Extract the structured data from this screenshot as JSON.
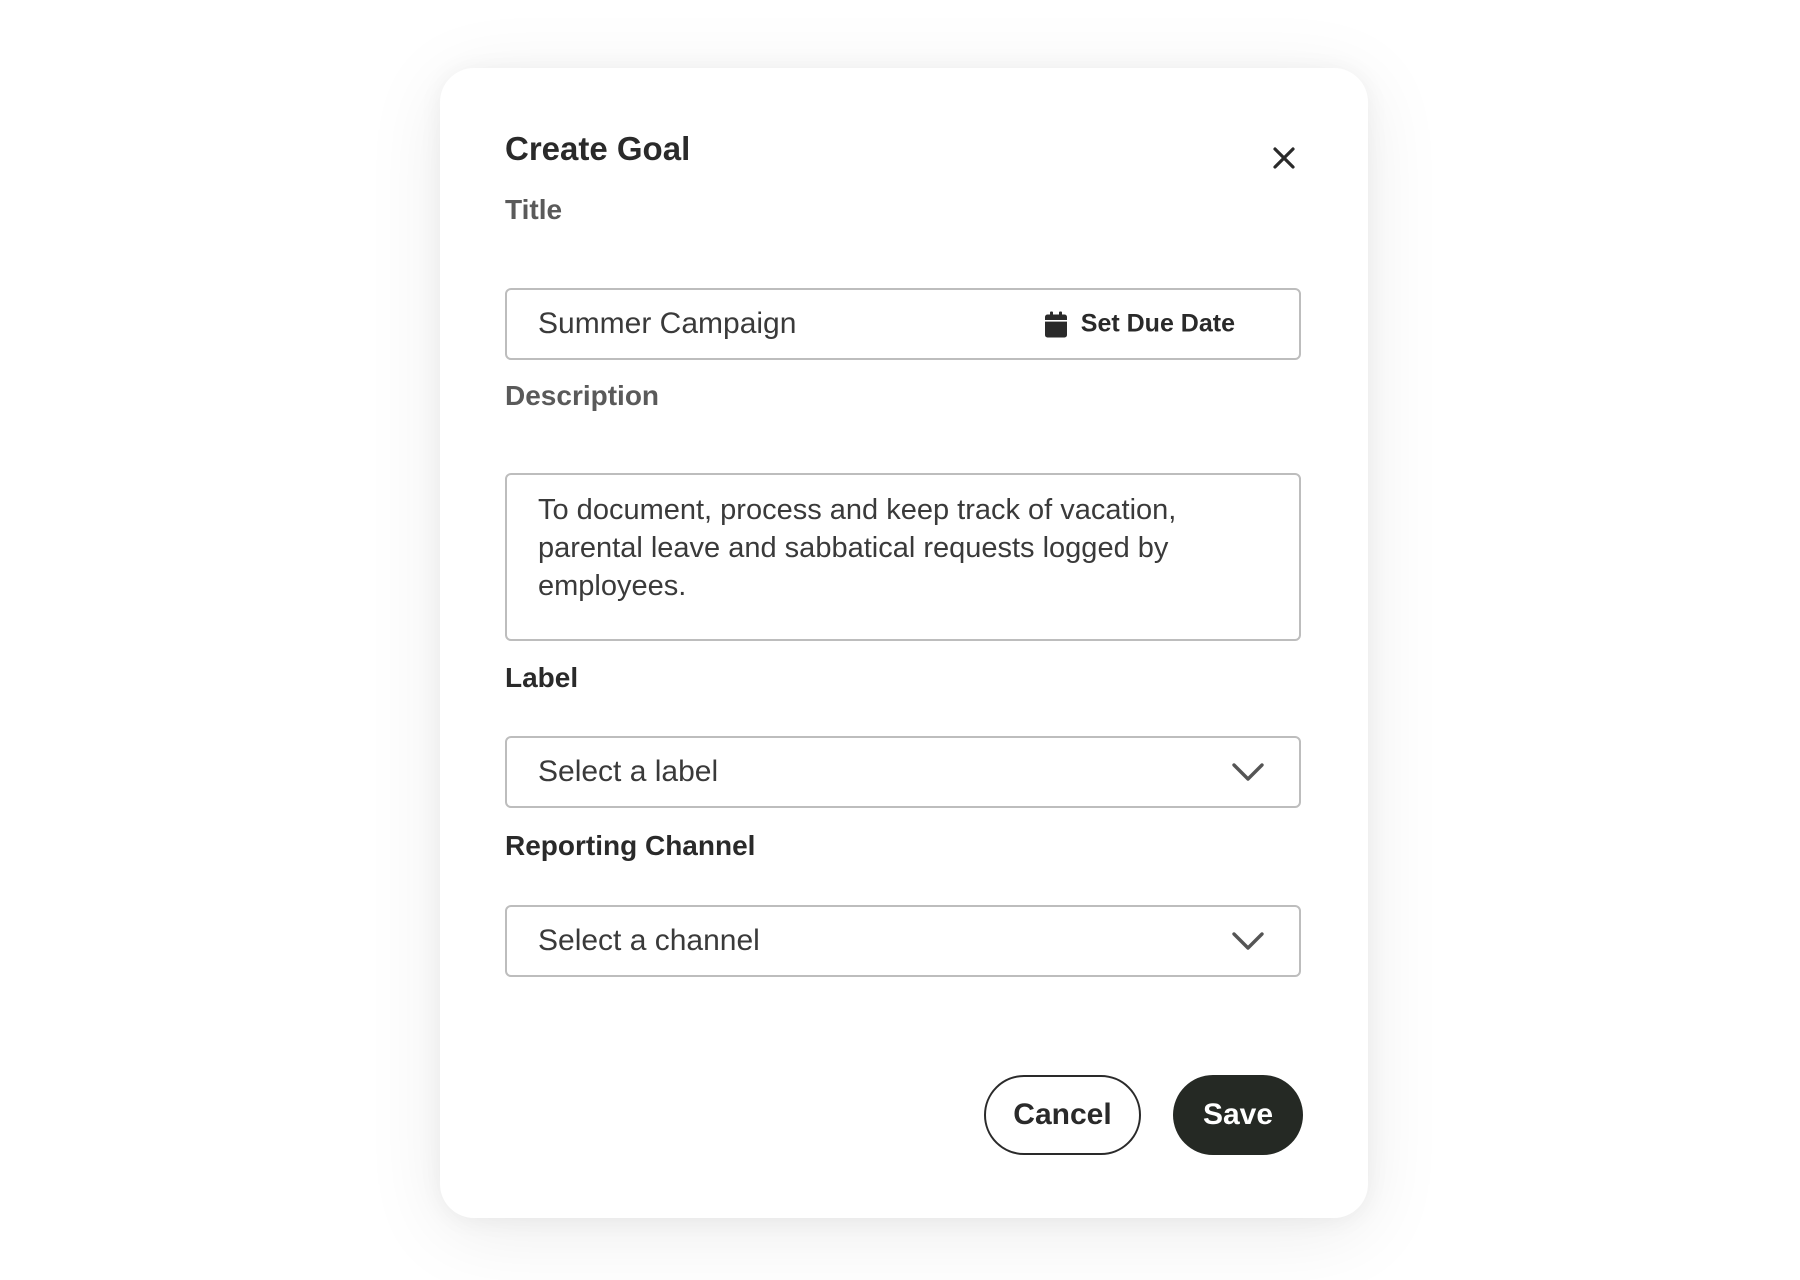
{
  "dialog": {
    "title": "Create Goal",
    "close_icon": "close-icon"
  },
  "fields": {
    "title": {
      "label": "Title",
      "value": "Summer Campaign",
      "due_date_label": "Set Due Date",
      "due_date_icon": "calendar-icon"
    },
    "description": {
      "label": "Description",
      "value": "To document, process and keep track of vacation, parental leave and sabbatical requests logged by employees."
    },
    "label": {
      "label": "Label",
      "placeholder": "Select a label",
      "icon": "chevron-down-icon"
    },
    "reporting_channel": {
      "label": "Reporting Channel",
      "placeholder": "Select a channel",
      "icon": "chevron-down-icon"
    }
  },
  "actions": {
    "cancel_label": "Cancel",
    "save_label": "Save"
  },
  "colors": {
    "primary_button": "#252924",
    "border": "#bdbdbd",
    "text": "#2a2a2a"
  }
}
